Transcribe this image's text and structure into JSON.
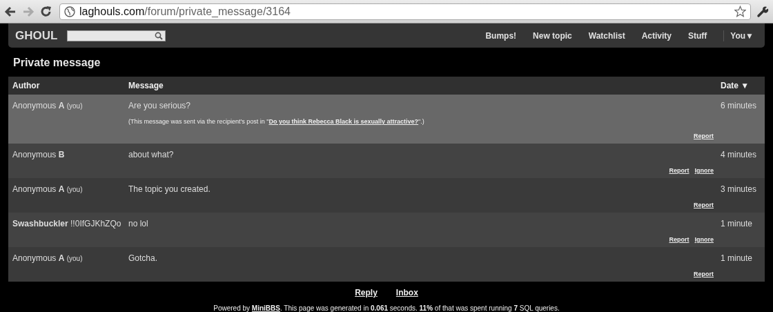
{
  "browser": {
    "url_host": "laghouls.com",
    "url_path": "/forum/private_message/3164"
  },
  "site": {
    "logo": "GHOUL",
    "nav": [
      {
        "label": "Bumps!",
        "kind": "link"
      },
      {
        "label": "New topic",
        "kind": "link"
      },
      {
        "label": "Watchlist",
        "kind": "link"
      },
      {
        "label": "Activity",
        "kind": "link"
      },
      {
        "label": "Stuff",
        "kind": "link"
      },
      {
        "label": "You▼",
        "kind": "menu"
      }
    ]
  },
  "page_title": "Private message",
  "table": {
    "columns": [
      "Author",
      "Message",
      "Date ▼"
    ],
    "rows": [
      {
        "author": "Anonymous **A**",
        "you_tag": "(you)",
        "message": "Are you serious?",
        "note": {
          "before": "(This message was sent via the recipient's post in \"",
          "link": "Do you think Rebecca Black is sexually attractive?",
          "after": "\".)"
        },
        "date": "6 minutes",
        "actions": [
          "Report"
        ],
        "selected": true
      },
      {
        "author": "Anonymous **B**",
        "message": "about what?",
        "date": "4 minutes",
        "actions": [
          "Report",
          "Ignore"
        ],
        "selected": false
      },
      {
        "author": "Anonymous **A**",
        "you_tag": "(you)",
        "message": "The topic you created.",
        "date": "3 minutes",
        "actions": [
          "Report"
        ],
        "selected": false
      },
      {
        "author": "**Swashbuckler** !!0IfGJKhZQo",
        "message": "no lol",
        "date": "1 minute",
        "actions": [
          "Report",
          "Ignore"
        ],
        "selected": false
      },
      {
        "author": "Anonymous **A**",
        "you_tag": "(you)",
        "message": "Gotcha.",
        "date": "1 minute",
        "actions": [
          "Report"
        ],
        "selected": false
      }
    ]
  },
  "footer": {
    "links": [
      "Reply",
      "Inbox"
    ],
    "powered_before": "Powered by ",
    "powered_link": "MiniBBS",
    "powered_after": ". This page was generated in **0.061** seconds. **11%** of that was spent running **7** SQL queries."
  }
}
